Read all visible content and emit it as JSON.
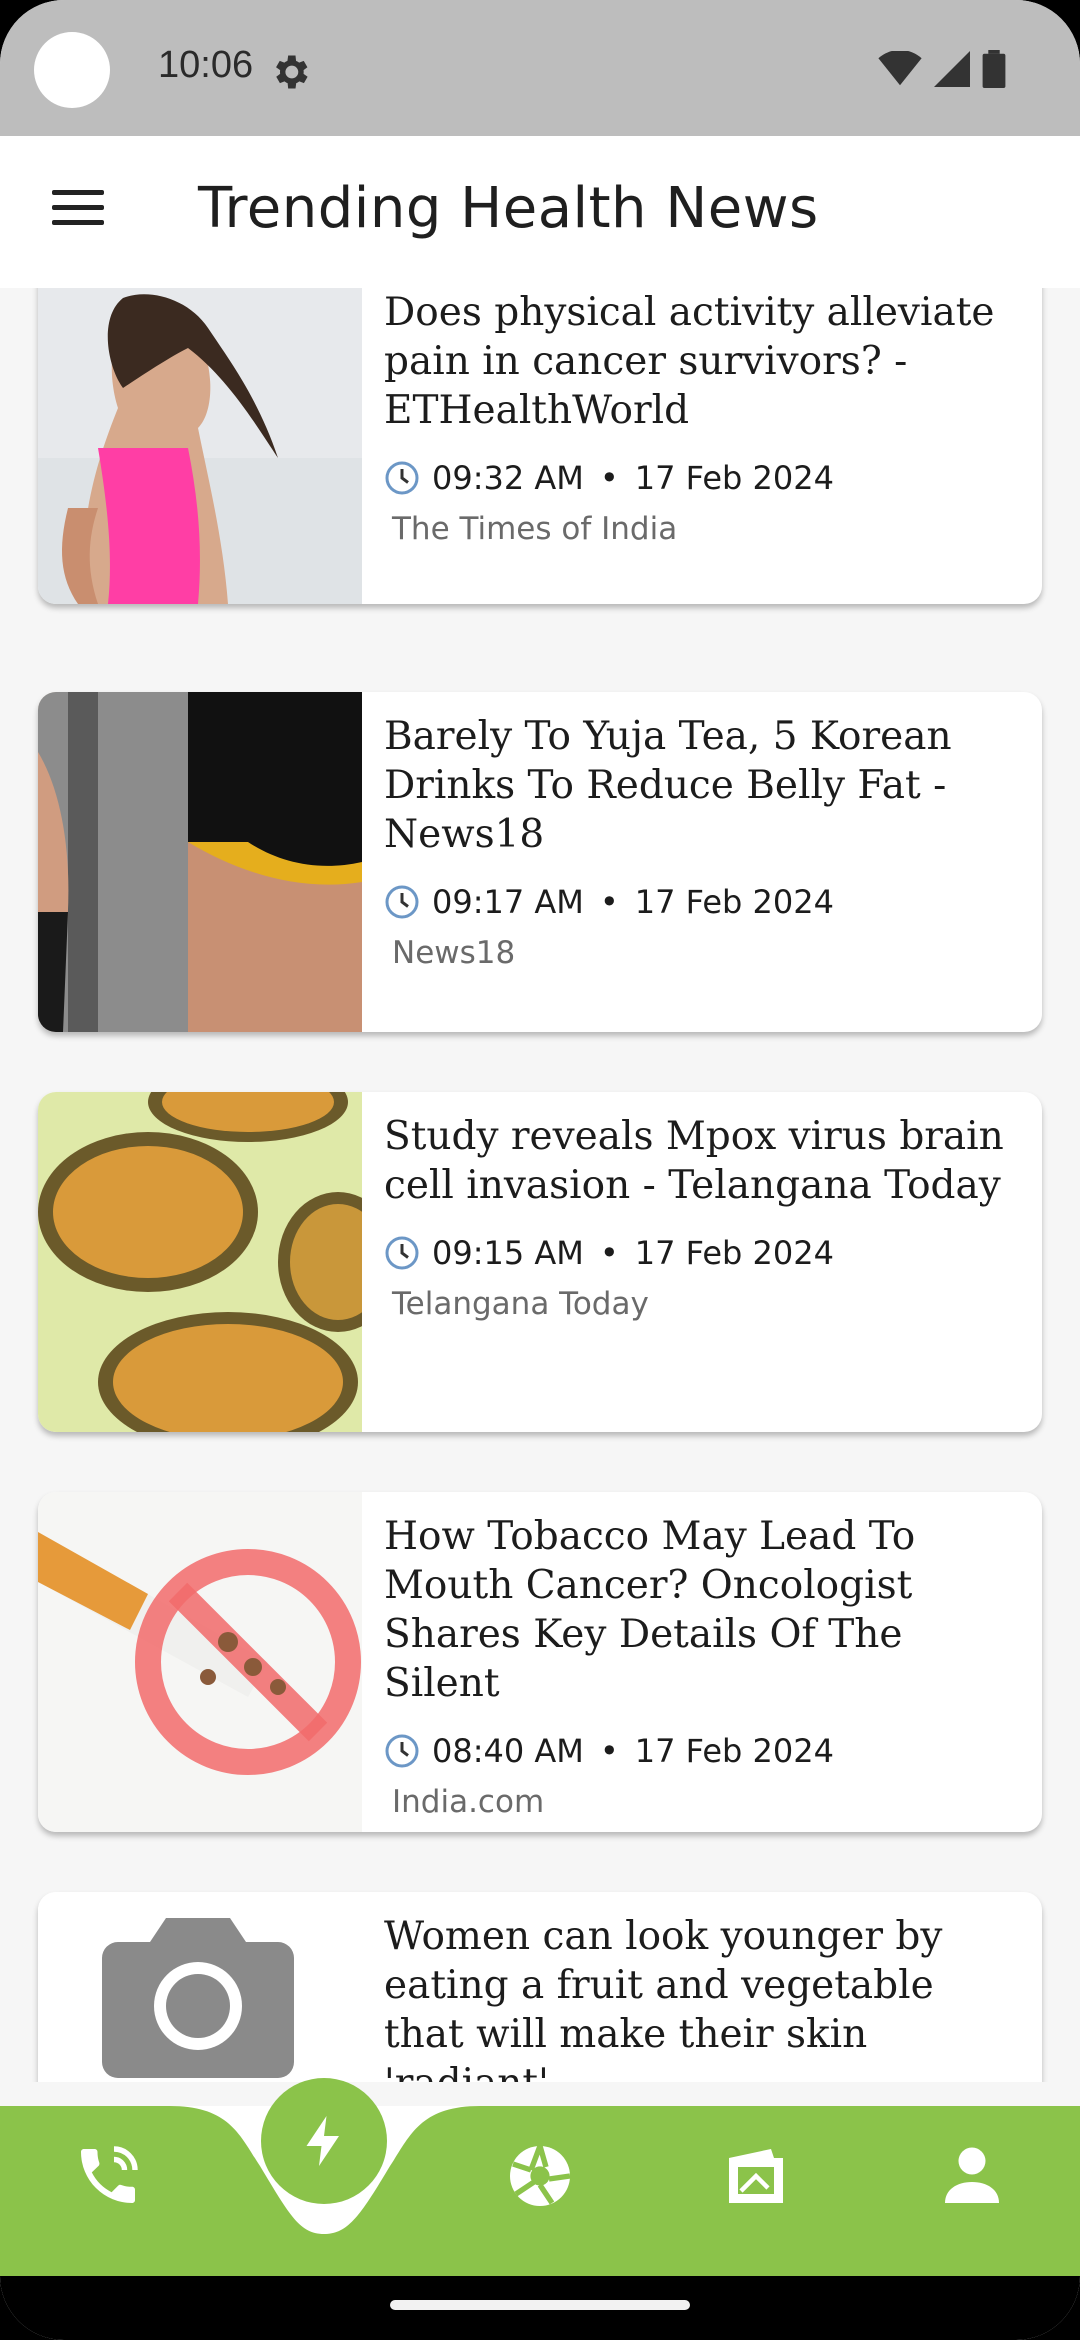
{
  "status_bar": {
    "time": "10:06"
  },
  "app_bar": {
    "title": "Trending Health News"
  },
  "articles": [
    {
      "headline": "Does physical activity alleviate pain in cancer survivors? - ETHealthWorld",
      "time": "09:32 AM",
      "date": "17 Feb 2024",
      "source": "The Times of India"
    },
    {
      "headline": "Barely To Yuja Tea, 5 Korean Drinks To Reduce Belly Fat - News18",
      "time": "09:17 AM",
      "date": "17 Feb 2024",
      "source": "News18"
    },
    {
      "headline": "Study reveals Mpox virus brain cell invasion - Telangana Today",
      "time": "09:15 AM",
      "date": "17 Feb 2024",
      "source": "Telangana Today"
    },
    {
      "headline": "How Tobacco May Lead To Mouth Cancer? Oncologist Shares Key Details Of The Silent",
      "time": "08:40 AM",
      "date": "17 Feb 2024",
      "source": "India.com"
    },
    {
      "headline": "Women can look younger by eating a fruit and vegetable that will make their skin 'radiant' -",
      "time": "",
      "date": "",
      "source": ""
    }
  ],
  "bottom_nav": {
    "items": [
      "phone-icon",
      "lightning-icon",
      "aperture-icon",
      "news-icon",
      "person-icon"
    ],
    "active": "lightning-icon",
    "accent": "#8bc34a"
  },
  "meta_separator": "•"
}
